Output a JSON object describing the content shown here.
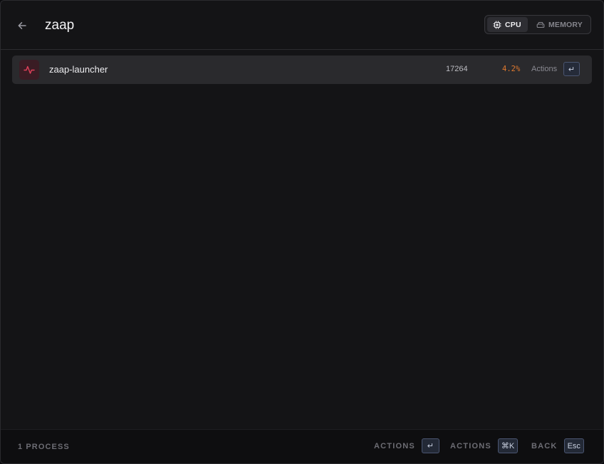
{
  "search": {
    "value": "zaap",
    "placeholder": ""
  },
  "sort_toggle": {
    "options": [
      {
        "label": "CPU",
        "icon": "cpu-icon",
        "active": true
      },
      {
        "label": "MEMORY",
        "icon": "memory-icon",
        "active": false
      }
    ]
  },
  "processes": [
    {
      "name": "zaap-launcher",
      "pid": "17264",
      "cpu": "4.2%",
      "actions_label": "Actions",
      "enter_key": "↵",
      "icon": "activity-icon"
    }
  ],
  "footer": {
    "count_label": "1 PROCESS",
    "shortcuts": [
      {
        "label": "ACTIONS",
        "key": "↵"
      },
      {
        "label": "ACTIONS",
        "key": "⌘K"
      },
      {
        "label": "BACK",
        "key": "Esc"
      }
    ]
  },
  "colors": {
    "background": "#141416",
    "row_selected": "#2a2a2d",
    "cpu_value": "#e0792e",
    "icon_accent": "#e0405a",
    "key_border": "#4a5570"
  }
}
